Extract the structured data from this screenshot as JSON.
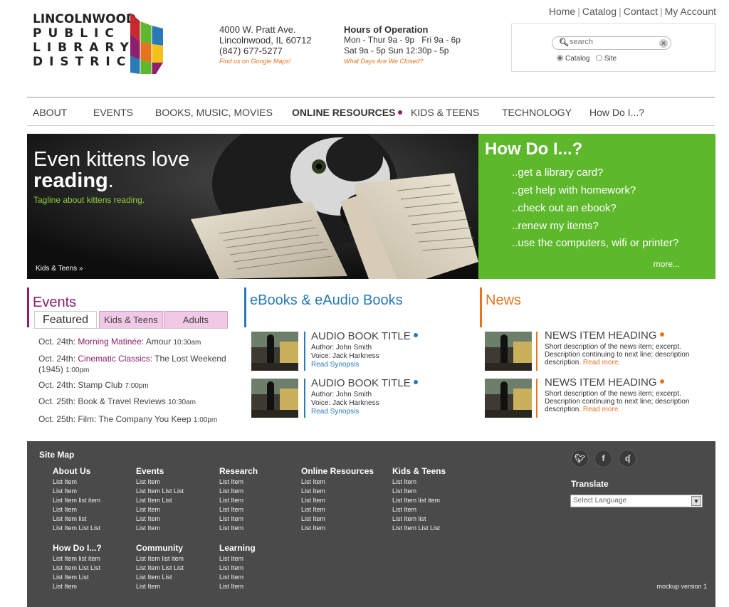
{
  "logo": {
    "line1": "LINCOLNWOOD",
    "line2": "PUBLIC",
    "line3": "LIBRARY",
    "line4": "DISTRICT"
  },
  "address": {
    "street": "4000 W. Pratt Ave.",
    "city": "Lincolnwood, IL 60712",
    "phone": "(847) 677-5277",
    "map_link": "Find us on Google Maps!"
  },
  "hours": {
    "title": "Hours of Operation",
    "weekdays": "Mon - Thur 9a - 9p",
    "friday": "Fri 9a - 6p",
    "weekend": "Sat 9a - 5p  Sun 12:30p - 5p",
    "closed_link": "What Days Are We Closed?"
  },
  "toplinks": [
    "Home",
    "Catalog",
    "Contact",
    "My Account"
  ],
  "search": {
    "placeholder": "search",
    "scope_catalog": "Catalog",
    "scope_site": "Site",
    "selected_scope": "Catalog"
  },
  "nav": [
    "ABOUT",
    "EVENTS",
    "BOOKS, MUSIC, MOVIES",
    "ONLINE RESOURCES",
    "KIDS & TEENS",
    "TECHNOLOGY",
    "How Do I...?"
  ],
  "hero": {
    "title_line1": "Even kittens love",
    "title_line2": "reading",
    "title_period": ".",
    "tagline": "Tagline about kittens reading.",
    "crumb": "Kids & Teens »"
  },
  "howdo": {
    "title": "How Do I...?",
    "items": [
      "..get a library card?",
      "..get help with homework?",
      "..check out an ebook?",
      "..renew my items?",
      "..use the computers, wifi or printer?"
    ],
    "more": "more..."
  },
  "events": {
    "title": "Events",
    "tabs": [
      "Featured",
      "Kids & Teens",
      "Adults"
    ],
    "items": [
      {
        "date": "Oct. 24th: ",
        "name": "Morning Matinée",
        "rest": ": Amour ",
        "time": "10:30am"
      },
      {
        "date": "Oct. 24th: ",
        "name": "Cinematic Classics",
        "rest": ": The Lost Weekend (1945) ",
        "time": "1:00pm"
      },
      {
        "date": "Oct. 24th: ",
        "name": "",
        "rest": "Stamp Club ",
        "time": "7:00pm"
      },
      {
        "date": "Oct. 25th: ",
        "name": "",
        "rest": "Book & Travel Reviews ",
        "time": "10:30am"
      },
      {
        "date": "Oct. 25th: ",
        "name": "",
        "rest": "Film: The Company You Keep ",
        "time": "1:00pm"
      }
    ]
  },
  "ebooks": {
    "title": "eBooks & eAudio Books",
    "items": [
      {
        "title": "AUDIO BOOK TITLE",
        "author": "Author: John Smith",
        "voice": "Voice: Jack Harkness",
        "link": "Read Synopsis"
      },
      {
        "title": "AUDIO BOOK TITLE",
        "author": "Author: John Smith",
        "voice": "Voice: Jack Harkness",
        "link": "Read Synopsis"
      }
    ]
  },
  "news": {
    "title": "News",
    "items": [
      {
        "heading": "NEWS ITEM HEADING",
        "desc": "Short description of the news item; excerpt. Description continuing to next line; description description. ",
        "link": "Read more."
      },
      {
        "heading": "NEWS ITEM HEADING",
        "desc": "Short description of the news item; excerpt. Description continuing to next line; description description. ",
        "link": "Read more."
      }
    ]
  },
  "footer": {
    "sitemap_title": "Site Map",
    "columns": [
      {
        "heading": "About Us",
        "items": [
          "List Item",
          "List Item",
          "List Item list item",
          "List Item",
          "List Item list",
          "List Item List List"
        ]
      },
      {
        "heading": "Events",
        "items": [
          "List Item",
          "List Item List List",
          "List Item List",
          "List Item",
          "List Item",
          "List Item"
        ]
      },
      {
        "heading": "Research",
        "items": [
          "List Item",
          "List Item",
          "List Item",
          "List Item",
          "List Item",
          "List Item"
        ]
      },
      {
        "heading": "Online Resources",
        "items": [
          "List Item",
          "List Item",
          "List Item",
          "List Item",
          "List Item",
          "List Item"
        ]
      },
      {
        "heading": "Kids & Teens",
        "items": [
          "List Item",
          "List Item",
          "List Item list item",
          "List Item",
          "List Item list",
          "List Item List List"
        ]
      },
      {
        "heading": "How Do I...?",
        "items": [
          "List Item list item",
          "List Item List List",
          "List Item List",
          "List Item"
        ]
      },
      {
        "heading": "Community",
        "items": [
          "List Item list item",
          "List Item List List",
          "List Item List",
          "List Item"
        ]
      },
      {
        "heading": "Learning",
        "items": [
          "List Item",
          "List Item",
          "List Item",
          "List Item"
        ]
      }
    ],
    "social_icons": [
      "twitter-icon",
      "facebook-icon",
      "rss-icon"
    ],
    "translate_title": "Translate",
    "language_placeholder": "Select Language",
    "mockup": "mockup version 1"
  },
  "colors": {
    "events": "#8e1f6e",
    "ebooks": "#2a7ab5",
    "news": "#e8731f",
    "howdo_bg": "#5db82b",
    "footer_bg": "#4a4a4a"
  }
}
